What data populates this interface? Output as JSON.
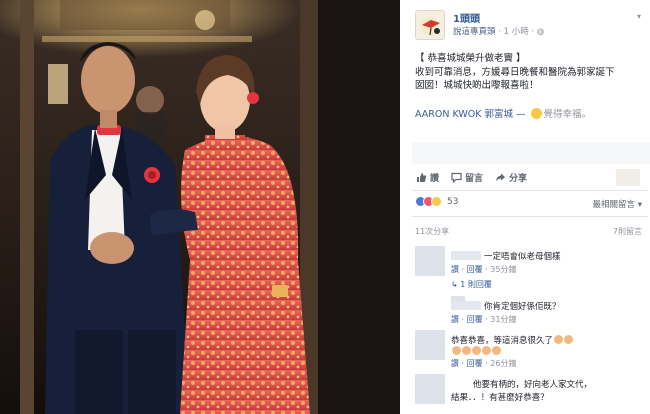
{
  "post": {
    "page_name": "1頭頭",
    "page_sub": "說這專頁頭",
    "time": "1 小時",
    "body_line1": "【 恭喜城城榮升做老竇 】",
    "body_line2": "收到可靠消息，方媛尋日晚餐和醫院為郭家誕下",
    "body_line3": "囡囡！城城快啲出嚟報喜啦！",
    "mention_name": "AARON KWOK 郭富城",
    "feeling": "覺得幸福。"
  },
  "actions": {
    "like": "讚",
    "comment": "留言",
    "share": "分享"
  },
  "stats": {
    "reaction_count": "53",
    "sort_label": "最相關留言",
    "shares": "11次分享",
    "previous_comments": "7則留言"
  },
  "comments": [
    {
      "text": "一定唔會似老母個樣",
      "like_label": "讚",
      "reply_label": "回覆",
      "time": "35分鐘",
      "replies": "1 則回覆"
    },
    {
      "text": "你肯定個好係佢既？",
      "like_label": "讚",
      "reply_label": "回覆",
      "time": "31分鐘"
    },
    {
      "text": "恭喜恭喜，等這消息很久了",
      "like_label": "讚",
      "reply_label": "回覆",
      "time": "26分鐘"
    },
    {
      "text_line1": "他要有柄的，好向老人家文代，",
      "text_line2": "結果．．！有甚麼好恭喜？"
    }
  ],
  "colors": {
    "link_blue": "#365899",
    "meta_gray": "#90949c",
    "like_reaction": "#4a76d8",
    "love_reaction": "#f25268",
    "haha_reaction": "#f7c948"
  }
}
